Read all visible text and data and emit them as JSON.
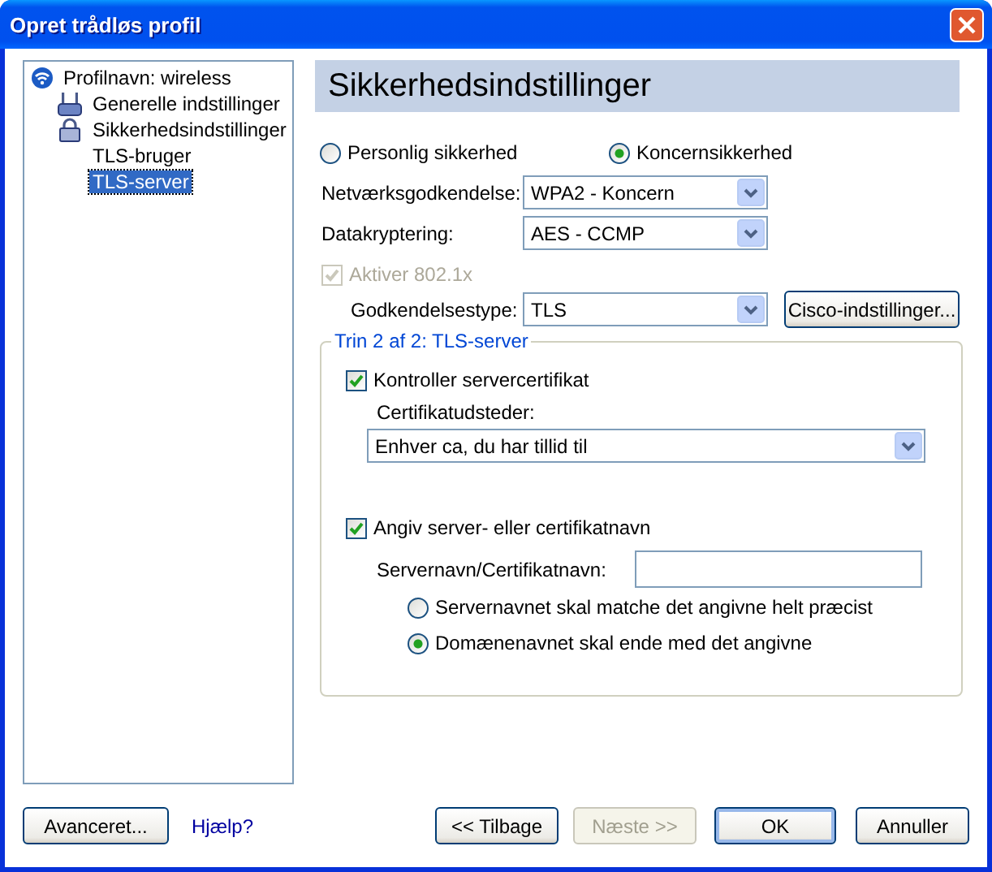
{
  "window": {
    "title": "Opret trådløs profil"
  },
  "tree": [
    {
      "label": "Profilnavn: wireless",
      "kind": "profile",
      "selected": false,
      "children": [
        {
          "label": "Generelle indstillinger",
          "kind": "general",
          "selected": false
        },
        {
          "label": "Sikkerhedsindstillinger",
          "kind": "security",
          "selected": false,
          "children": [
            {
              "label": "TLS-bruger",
              "selected": false
            },
            {
              "label": "TLS-server",
              "selected": true
            }
          ]
        }
      ]
    }
  ],
  "header": "Sikkerhedsindstillinger",
  "security_modes": [
    {
      "label": "Personlig sikkerhed",
      "selected": false
    },
    {
      "label": "Koncernsikkerhed",
      "selected": true
    }
  ],
  "fields": [
    {
      "label": "Netværksgodkendelse:",
      "value": "WPA2 - Koncern"
    },
    {
      "label": "Datakryptering:",
      "value": "AES - CCMP"
    }
  ],
  "enable_8021x": {
    "label": "Aktiver 802.1x",
    "checked": true,
    "disabled": true
  },
  "auth_type": {
    "label": "Godkendelsestype:",
    "value": "TLS"
  },
  "cisco_button": "Cisco-indstillinger...",
  "step_group": {
    "title": "Trin 2 af 2: TLS-server",
    "verify_cert": {
      "label": "Kontroller servercertifikat",
      "checked": true
    },
    "issuer": {
      "label": "Certifikatudsteder:",
      "value": "Enhver ca, du har tillid til"
    },
    "specify_name": {
      "label": "Angiv server- eller certifikatnavn",
      "checked": true
    },
    "server_name": {
      "label": "Servernavn/Certifikatnavn:"
    },
    "match_options": [
      {
        "label": "Servernavnet skal matche det angivne helt præcist",
        "selected": false
      },
      {
        "label": "Domænenavnet skal ende med det angivne",
        "selected": true
      }
    ]
  },
  "footer": {
    "advanced_button": "Avanceret...",
    "help_link": "Hjælp?",
    "nav_buttons": [
      {
        "label": "<< Tilbage",
        "disabled": false,
        "default": false
      },
      {
        "label": "Næste >>",
        "disabled": true,
        "default": false
      },
      {
        "label": "OK",
        "disabled": false,
        "default": true
      },
      {
        "label": "Annuller",
        "disabled": false,
        "default": false
      }
    ]
  }
}
